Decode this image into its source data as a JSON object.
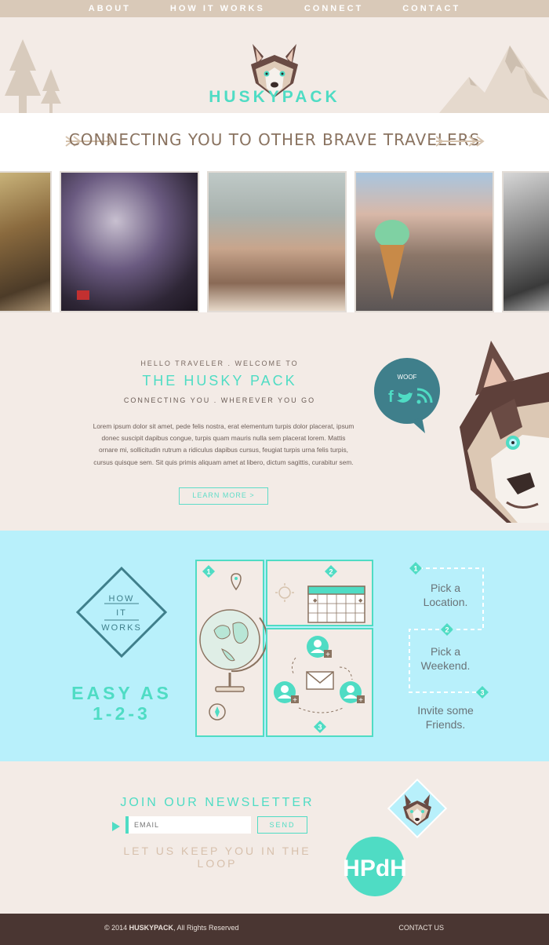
{
  "nav": {
    "items": [
      "ABOUT",
      "HOW IT WORKS",
      "CONNECT",
      "CONTACT"
    ]
  },
  "header": {
    "brand": "HUSKYPACK",
    "tagline": "CONNECTING YOU TO OTHER BRAVE TRAVELERS"
  },
  "gallery": {
    "photos": [
      "street-photo",
      "party-photo",
      "group-photo",
      "ice-cream-photo",
      "portrait-photo"
    ]
  },
  "welcome": {
    "hello": "HELLO TRAVELER . WELCOME TO",
    "title": "THE HUSKY PACK",
    "subtitle": "CONNECTING YOU . WHEREVER YOU GO",
    "body": "Lorem ipsum dolor sit amet, pede felis nostra, erat elementum turpis dolor placerat, ipsum donec suscipit dapibus congue, turpis quam mauris nulla sem placerat lorem. Mattis ornare mi, sollicitudin rutrum a ridiculus dapibus cursus, feugiat turpis urna felis turpis, cursus quisque sem. Sit quis primis aliquam amet at libero, dictum sagittis, curabitur sem.",
    "button": "LEARN MORE >",
    "bubble_label": "WOOF"
  },
  "how": {
    "diamond": [
      "HOW",
      "IT",
      "WORKS"
    ],
    "easy_line1": "EASY AS",
    "easy_line2": "1-2-3",
    "panel_numbers": [
      "1",
      "2",
      "3"
    ],
    "steps": [
      {
        "num": "1",
        "line1": "Pick a",
        "line2": "Location."
      },
      {
        "num": "2",
        "line1": "Pick a",
        "line2": "Weekend."
      },
      {
        "num": "3",
        "line1": "Invite some",
        "line2": "Friends."
      }
    ]
  },
  "newsletter": {
    "title": "JOIN OUR NEWSLETTER",
    "placeholder": "EMAIL",
    "send": "SEND",
    "loop": "LET US KEEP YOU IN THE LOOP",
    "badge_text": "HPdH"
  },
  "footer": {
    "copyright_prefix": "© 2014 ",
    "copyright_brand": "HUSKYPACK",
    "copyright_suffix": ", All Rights Reserved",
    "contact": "CONTACT US"
  },
  "colors": {
    "accent": "#4fdcc4",
    "nav_bg": "#d9c9b8",
    "page_bg": "#f3ebe6",
    "how_bg": "#b8f0fb",
    "footer_bg": "#4a3632",
    "bubble": "#3f7f8b"
  }
}
